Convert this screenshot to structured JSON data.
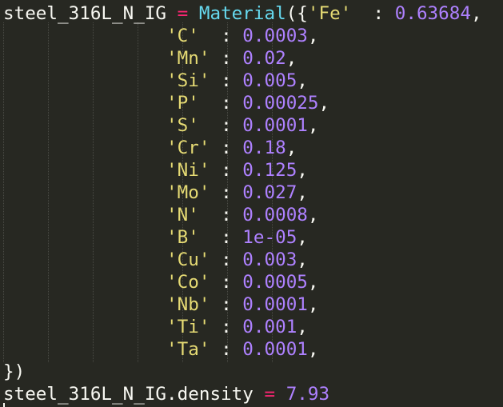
{
  "editor": {
    "colors": {
      "background": "#272822",
      "identifier": "#f8f8f2",
      "operator": "#f92672",
      "function": "#66d9ef",
      "string": "#e6db74",
      "number": "#ae81ff"
    },
    "first_line": {
      "variable": "steel_316L_N_IG",
      "assign": " = ",
      "function": "Material",
      "open": "({",
      "key": "'Fe'",
      "sep": "  : ",
      "value": "0.63684",
      "trail": ","
    },
    "entries": [
      {
        "key": "'C'",
        "sep": "  : ",
        "value": "0.0003",
        "trail": ","
      },
      {
        "key": "'Mn'",
        "sep": " : ",
        "value": "0.02",
        "trail": ","
      },
      {
        "key": "'Si'",
        "sep": " : ",
        "value": "0.005",
        "trail": ","
      },
      {
        "key": "'P'",
        "sep": "  : ",
        "value": "0.00025",
        "trail": ","
      },
      {
        "key": "'S'",
        "sep": "  : ",
        "value": "0.0001",
        "trail": ","
      },
      {
        "key": "'Cr'",
        "sep": " : ",
        "value": "0.18",
        "trail": ","
      },
      {
        "key": "'Ni'",
        "sep": " : ",
        "value": "0.125",
        "trail": ","
      },
      {
        "key": "'Mo'",
        "sep": " : ",
        "value": "0.027",
        "trail": ","
      },
      {
        "key": "'N'",
        "sep": "  : ",
        "value": "0.0008",
        "trail": ","
      },
      {
        "key": "'B'",
        "sep": "  : ",
        "value": "1e-05",
        "trail": ","
      },
      {
        "key": "'Cu'",
        "sep": " : ",
        "value": "0.003",
        "trail": ","
      },
      {
        "key": "'Co'",
        "sep": " : ",
        "value": "0.0005",
        "trail": ","
      },
      {
        "key": "'Nb'",
        "sep": " : ",
        "value": "0.0001",
        "trail": ","
      },
      {
        "key": "'Ti'",
        "sep": " : ",
        "value": "0.001",
        "trail": ","
      },
      {
        "key": "'Ta'",
        "sep": " : ",
        "value": "0.0001",
        "trail": ","
      }
    ],
    "closing_line": "})",
    "last_line": {
      "expression": "steel_316L_N_IG.density",
      "assign": " = ",
      "value": "7.93"
    }
  }
}
